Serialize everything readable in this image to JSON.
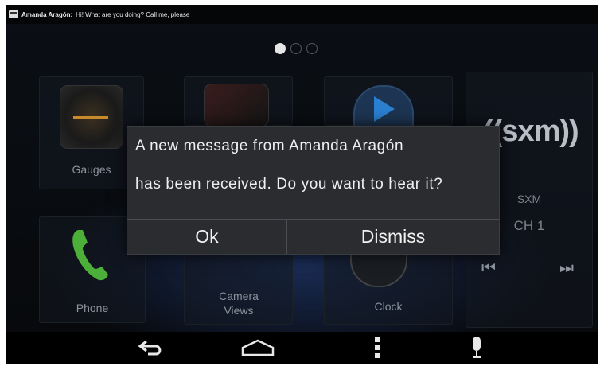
{
  "notification": {
    "sender": "Amanda Aragón:",
    "text": "Hi! What are you doing? Call me, please"
  },
  "pager": {
    "pages": 3,
    "active": 0
  },
  "tiles": {
    "gauges": "Gauges",
    "phone": "Phone",
    "camera_views": "Camera Views",
    "clock": "Clock"
  },
  "sxm": {
    "logo": "((sxm))",
    "name": "SXM",
    "channel": "CH 1"
  },
  "dialog": {
    "line1": "A new message from Amanda Aragón",
    "line2": "has been received. Do you want to hear it?",
    "ok_label": "Ok",
    "dismiss_label": "Dismiss"
  },
  "icons": {
    "back": "back-icon",
    "home": "home-icon",
    "menu": "menu-icon",
    "mic": "microphone-icon",
    "prev": "skip-previous-icon",
    "next": "skip-next-icon"
  },
  "colors": {
    "phone_green": "#4caf3a",
    "play_blue": "#2a7fd0",
    "dialog_bg": "#2a2c2f"
  }
}
